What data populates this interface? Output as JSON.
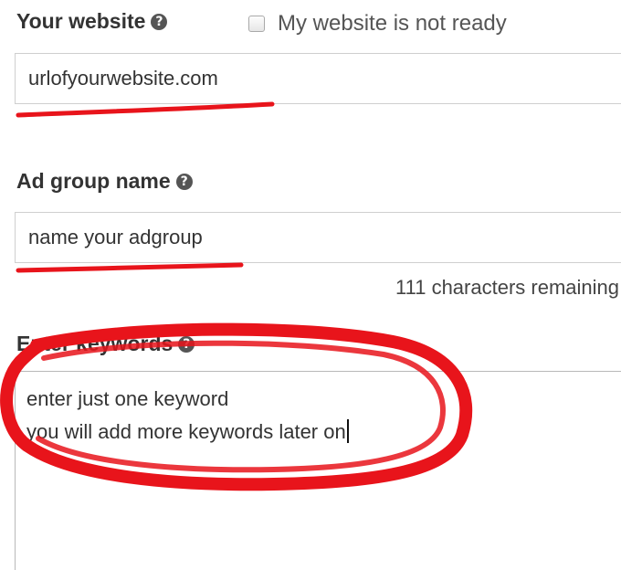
{
  "website": {
    "label": "Your website",
    "help_icon": "question-circle-icon",
    "not_ready_label": "My website is not ready",
    "not_ready_checked": false,
    "input_value": "urlofyourwebsite.com"
  },
  "ad_group": {
    "label": "Ad group name",
    "help_icon": "question-circle-icon",
    "input_value": "name your adgroup",
    "chars_remaining": "111 characters remaining"
  },
  "keywords": {
    "label": "Enter keywords",
    "help_icon": "question-circle-icon",
    "lines": [
      "enter just one keyword",
      "you will add more keywords later on"
    ]
  },
  "annotation_color": "#e8141b"
}
